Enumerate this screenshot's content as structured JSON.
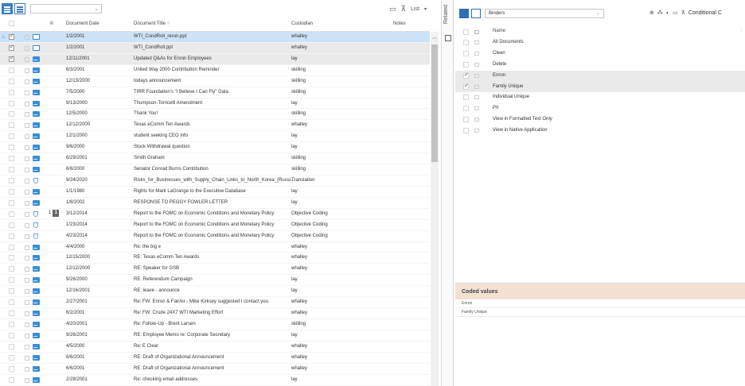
{
  "toolbar": {
    "list_label": "List"
  },
  "grid": {
    "headers": {
      "document_date": "Document Date",
      "document_title": "Document Title",
      "custodian": "Custodian",
      "notes": "Notes"
    },
    "rows": [
      {
        "date": "1/2/2001",
        "title": "WTI_CondRoll_rerun.ppt",
        "custodian": "whalley",
        "type": "ppt",
        "checked": true,
        "sel": "sel1"
      },
      {
        "date": "1/2/2001",
        "title": "WTI_CondRoll.ppt",
        "custodian": "whalley",
        "type": "ppt",
        "checked": true,
        "sel": "sel2"
      },
      {
        "date": "12/11/2001",
        "title": "Updated Q&As for Enron Employees",
        "custodian": "lay",
        "type": "email",
        "checked": true,
        "sel": "sel2"
      },
      {
        "date": "6/3/2001",
        "title": "United Way 2000 Contribution Reminder",
        "custodian": "skilling",
        "type": "email"
      },
      {
        "date": "12/13/2000",
        "title": "todays announcement",
        "custodian": "skilling",
        "type": "email"
      },
      {
        "date": "7/5/2000",
        "title": "TIRR Foundation's \"I Believe I Can Fly\" Gala",
        "custodian": "skilling",
        "type": "email"
      },
      {
        "date": "9/13/2000",
        "title": "Thompson-Torricelli Amendment",
        "custodian": "lay",
        "type": "email"
      },
      {
        "date": "12/5/2000",
        "title": "Thank You!",
        "custodian": "skilling",
        "type": "email"
      },
      {
        "date": "12/12/2000",
        "title": "Texas eComm Ten Awards",
        "custodian": "whalley",
        "type": "email"
      },
      {
        "date": "12/1/2000",
        "title": "student seeking CEO info",
        "custodian": "lay",
        "type": "email"
      },
      {
        "date": "9/6/2000",
        "title": "Stock Withdrawal question",
        "custodian": "lay",
        "type": "email"
      },
      {
        "date": "6/29/2001",
        "title": "Smith Graham",
        "custodian": "skilling",
        "type": "email"
      },
      {
        "date": "6/6/2000",
        "title": "Senator Conrad Burns Contribution",
        "custodian": "skilling",
        "type": "email"
      },
      {
        "date": "9/24/2020",
        "title": "Risks_for_Businesses_with_Supply_Chain_Links_to_North_Korea_(Russi...",
        "custodian": "Translation",
        "type": "pdf"
      },
      {
        "date": "1/1/1980",
        "title": "Rights for Mark LaGrange to the Executive Database",
        "custodian": "lay",
        "type": "email"
      },
      {
        "date": "1/8/2002",
        "title": "RESPONSE TO PEGGY FOWLER LETTER",
        "custodian": "lay",
        "type": "email"
      },
      {
        "date": "3/12/2014",
        "title": "Report to the FOMC on Economic Conditions and Monetary Policy",
        "custodian": "Objective Coding",
        "type": "pdf",
        "badge_left": "1",
        "badge_right": "1"
      },
      {
        "date": "1/23/2014",
        "title": "Report to the FOMC on Economic Conditions and Monetary Policy",
        "custodian": "Objective Coding",
        "type": "pdf"
      },
      {
        "date": "4/23/2014",
        "title": "Report to the FOMC on Economic Conditions and Monetary Policy",
        "custodian": "Objective Coding",
        "type": "pdf"
      },
      {
        "date": "4/4/2000",
        "title": "Re: the big e",
        "custodian": "whalley",
        "type": "email"
      },
      {
        "date": "12/15/2000",
        "title": "RE: Texas eComm Ten Awards",
        "custodian": "whalley",
        "type": "email"
      },
      {
        "date": "12/12/2000",
        "title": "RE: Speaker for GSB",
        "custodian": "whalley",
        "type": "email"
      },
      {
        "date": "9/26/2000",
        "title": "RE: Referendum Campaign",
        "custodian": "lay",
        "type": "email"
      },
      {
        "date": "12/16/2001",
        "title": "RE: leave - announce",
        "custodian": "lay",
        "type": "email"
      },
      {
        "date": "2/27/2001",
        "title": "Re: FW: Enron & FairAir - Mike Kirksey suggested I contact you",
        "custodian": "whalley",
        "type": "email"
      },
      {
        "date": "6/2/2001",
        "title": "Re: FW: Crude 24X7 WTI Marketing Effort",
        "custodian": "whalley",
        "type": "email"
      },
      {
        "date": "4/20/2001",
        "title": "Re: Follow-Up - Brent Larsen",
        "custodian": "skilling",
        "type": "email"
      },
      {
        "date": "9/26/2001",
        "title": "RE: Employee Memo re: Corporate Secretary",
        "custodian": "lay",
        "type": "email"
      },
      {
        "date": "4/5/2000",
        "title": "Re: E Clear",
        "custodian": "whalley",
        "type": "email"
      },
      {
        "date": "6/6/2001",
        "title": "RE: Draft of Organizational Announcement",
        "custodian": "whalley",
        "type": "email"
      },
      {
        "date": "6/6/2001",
        "title": "RE: Draft of Organizational Announcement",
        "custodian": "whalley",
        "type": "email"
      },
      {
        "date": "2/28/2001",
        "title": "Re: checking email addresses",
        "custodian": "lay",
        "type": "email"
      }
    ]
  },
  "related": {
    "label": "Related"
  },
  "binders": {
    "combo_value": "Binders",
    "conditional_label": "Conditional C",
    "name_header": "Name",
    "items": [
      {
        "label": "All Documents",
        "checked": false,
        "sel": false
      },
      {
        "label": "Clean",
        "checked": false,
        "sel": false
      },
      {
        "label": "Delete",
        "checked": false,
        "sel": false
      },
      {
        "label": "Enron",
        "checked": true,
        "sel": true
      },
      {
        "label": "Family Unique",
        "checked": true,
        "sel": true
      },
      {
        "label": "Individual Unique",
        "checked": false,
        "sel": false
      },
      {
        "label": "PII",
        "checked": false,
        "sel": false
      },
      {
        "label": "View in Formatted Text Only",
        "checked": false,
        "sel": false
      },
      {
        "label": "View in Native Application",
        "checked": false,
        "sel": false
      }
    ]
  },
  "coded": {
    "title": "Coded values",
    "values": [
      "Enron",
      "Family Unique"
    ]
  },
  "colors": {
    "accent": "#3a7cc1",
    "selection": "#cce2f6",
    "coded_header": "#f3e1d2"
  }
}
